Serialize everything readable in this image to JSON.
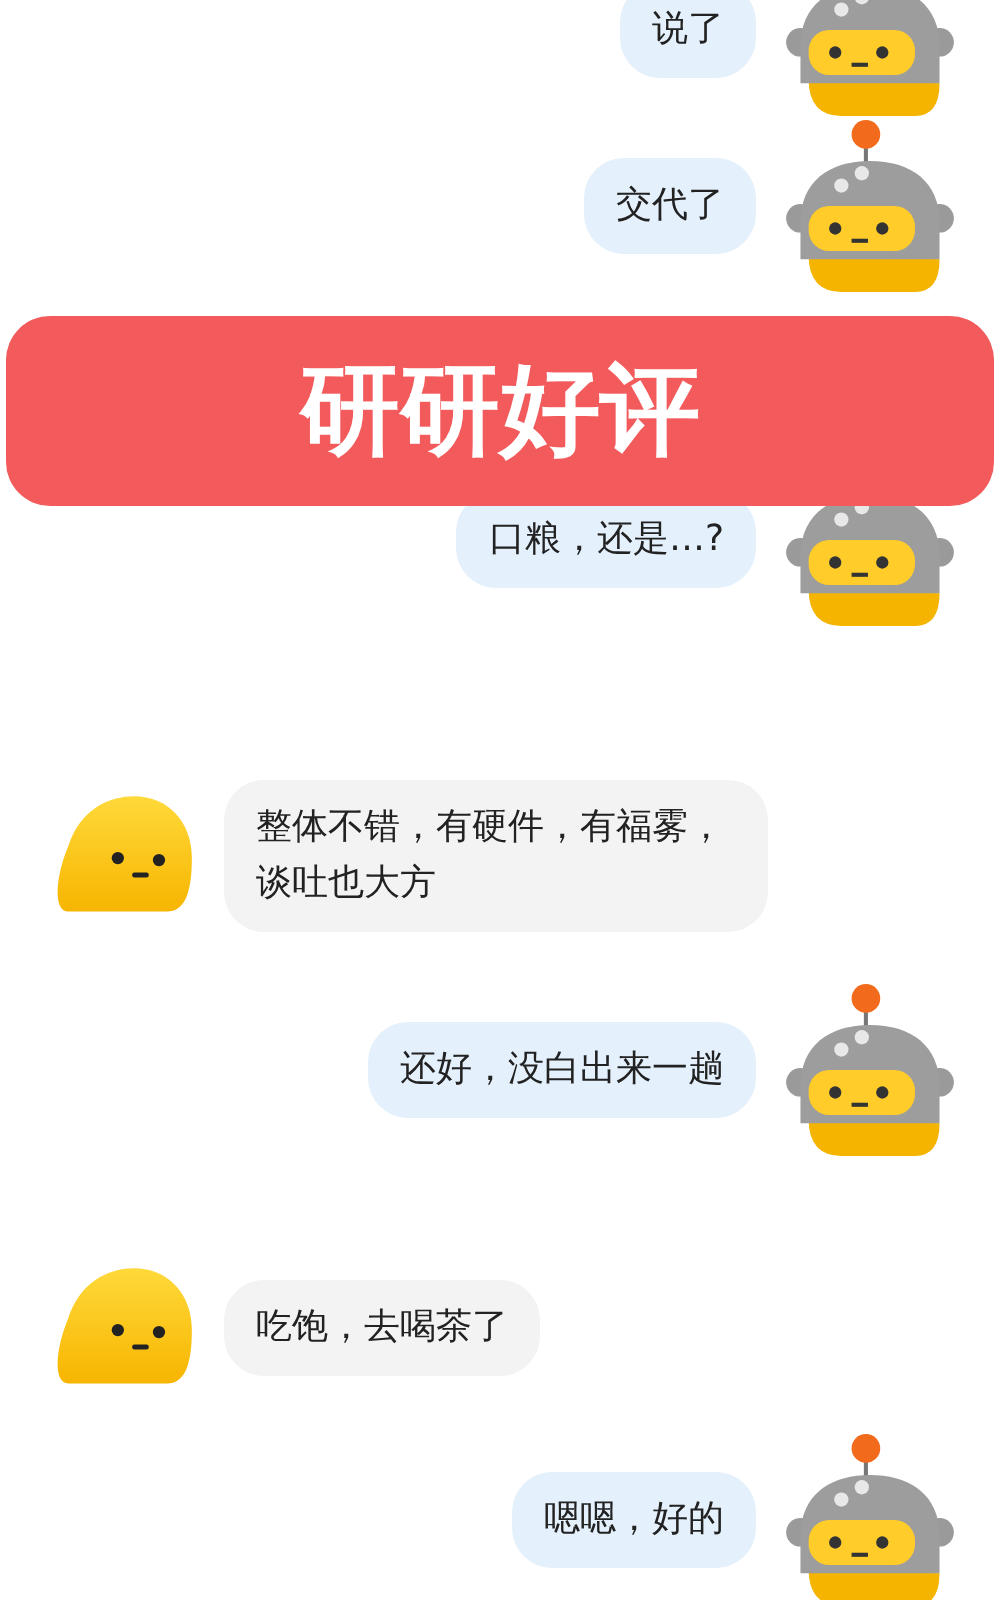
{
  "messages": [
    {
      "kind": "sent",
      "text": "说了"
    },
    {
      "kind": "sent",
      "text": "交代了"
    },
    {
      "kind": "sent",
      "text": "口粮，还是…?"
    },
    {
      "kind": "received",
      "text": "整体不错，有硬件，有福雾，谈吐也大方"
    },
    {
      "kind": "sent",
      "text": "还好，没白出来一趟"
    },
    {
      "kind": "received",
      "text": "吃饱，去喝茶了"
    },
    {
      "kind": "sent",
      "text": "嗯嗯，好的"
    }
  ],
  "banner": {
    "text": "研研好评"
  }
}
